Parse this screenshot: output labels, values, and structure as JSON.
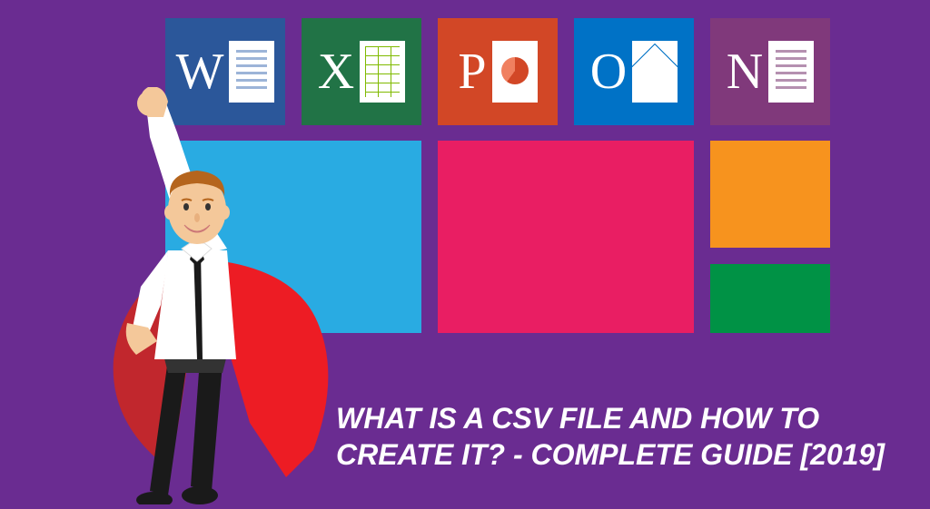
{
  "apps": {
    "word": {
      "letter": "W"
    },
    "excel": {
      "letter": "X"
    },
    "ppt": {
      "letter": "P"
    },
    "outlook": {
      "letter": "O"
    },
    "onenote": {
      "letter": "N"
    }
  },
  "caption": {
    "line1": "WHAT IS A CSV FILE AND HOW TO",
    "line2": "CREATE IT? - COMPLETE GUIDE [2019]"
  }
}
